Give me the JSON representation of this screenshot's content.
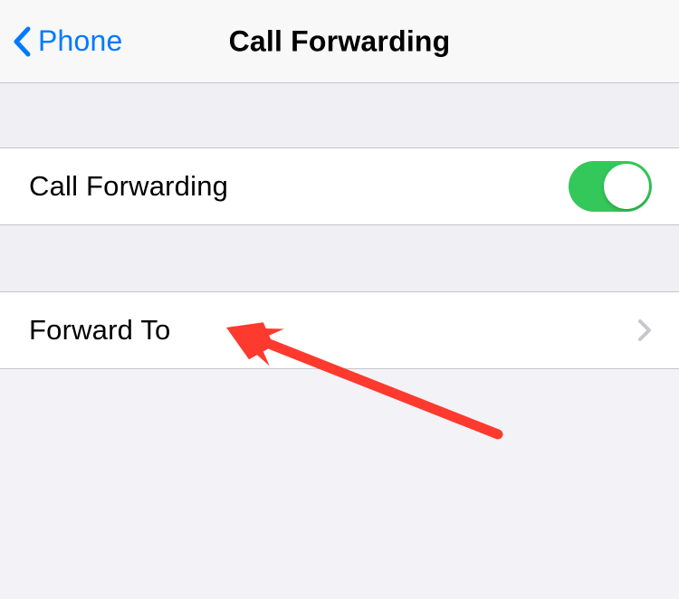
{
  "nav": {
    "back_label": "Phone",
    "title": "Call Forwarding"
  },
  "rows": {
    "call_forwarding": {
      "label": "Call Forwarding",
      "enabled": true
    },
    "forward_to": {
      "label": "Forward To"
    }
  },
  "colors": {
    "tint": "#007aff",
    "toggle_on": "#34c759",
    "annotation": "#fe3a2e"
  }
}
